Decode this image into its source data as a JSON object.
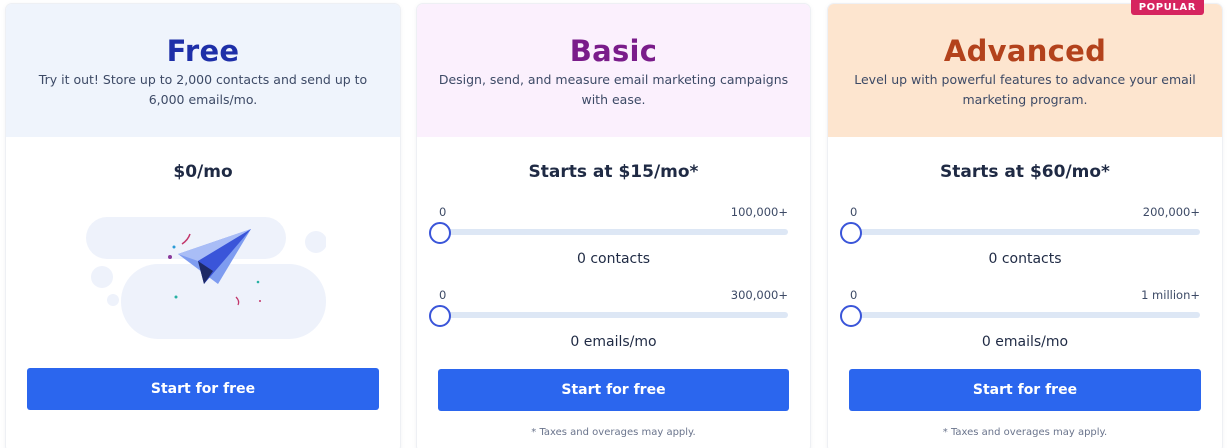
{
  "plans": {
    "free": {
      "title": "Free",
      "description": "Try it out! Store up to 2,000 contacts and send up to 6,000 emails/mo.",
      "price": "$0/mo",
      "button": "Start for free",
      "illustration_icon": "paper-plane-icon"
    },
    "basic": {
      "title": "Basic",
      "description": "Design, send, and measure email marketing campaigns with ease.",
      "price": "Starts at $15/mo*",
      "contacts": {
        "min": "0",
        "max": "100,000+",
        "value_label": "0 contacts",
        "level": 0
      },
      "emails": {
        "min": "0",
        "max": "300,000+",
        "value_label": "0 emails/mo",
        "level": 0
      },
      "button": "Start for free",
      "footnote": "* Taxes and overages may apply."
    },
    "advanced": {
      "title": "Advanced",
      "badge": "POPULAR",
      "description": "Level up with powerful features to advance your email marketing program.",
      "price": "Starts at $60/mo*",
      "contacts": {
        "min": "0",
        "max": "200,000+",
        "value_label": "0 contacts",
        "level": 0
      },
      "emails": {
        "min": "0",
        "max": "1 million+",
        "value_label": "0 emails/mo",
        "level": 0
      },
      "button": "Start for free",
      "footnote": "* Taxes and overages may apply."
    }
  },
  "colors": {
    "free_title": "#1e2fa8",
    "basic_title": "#7a1c8a",
    "advanced_title": "#b3421c",
    "button": "#2b66ee",
    "badge": "#d6245f",
    "free_header_bg": "#eff4fc",
    "basic_header_bg": "#fbf0fd",
    "advanced_header_bg": "#fde5cf"
  }
}
